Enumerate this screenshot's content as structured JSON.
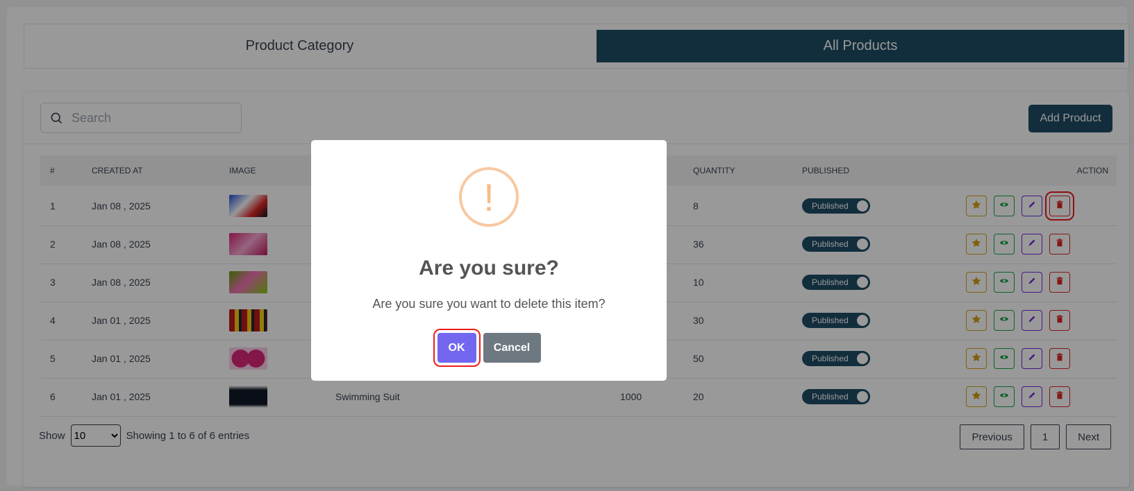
{
  "tabs": {
    "category": "Product Category",
    "all": "All Products"
  },
  "toolbar": {
    "search_placeholder": "Search",
    "add_label": "Add Product"
  },
  "table": {
    "headers": {
      "num": "#",
      "created": "CREATED AT",
      "image": "IMAGE",
      "quantity": "QUANTITY",
      "published": "PUBLISHED",
      "action": "ACTION"
    },
    "rows": [
      {
        "num": "1",
        "created": "Jan 08 , 2025",
        "name": "",
        "price": "",
        "quantity": "8",
        "published": "Published"
      },
      {
        "num": "2",
        "created": "Jan 08 , 2025",
        "name": "",
        "price": "",
        "quantity": "36",
        "published": "Published"
      },
      {
        "num": "3",
        "created": "Jan 08 , 2025",
        "name": "",
        "price": "",
        "quantity": "10",
        "published": "Published"
      },
      {
        "num": "4",
        "created": "Jan 01 , 2025",
        "name": "",
        "price": "",
        "quantity": "30",
        "published": "Published"
      },
      {
        "num": "5",
        "created": "Jan 01 , 2025",
        "name": "",
        "price": "",
        "quantity": "50",
        "published": "Published"
      },
      {
        "num": "6",
        "created": "Jan 01 , 2025",
        "name": "Swimming Suit",
        "price": "1000",
        "quantity": "20",
        "published": "Published"
      }
    ]
  },
  "footer": {
    "show_label": "Show",
    "page_size": "10",
    "entries_text": "Showing 1 to 6 of 6 entries",
    "prev": "Previous",
    "page": "1",
    "next": "Next"
  },
  "modal": {
    "icon": "!",
    "title": "Are you sure?",
    "text": "Are you sure you want to delete this item?",
    "ok": "OK",
    "cancel": "Cancel"
  },
  "colors": {
    "primary": "#1f4e66",
    "confirm": "#7367f0",
    "cancel": "#6e7881",
    "warning": "#f8bb86"
  },
  "icons": {
    "star": "star-icon",
    "view": "eye-icon",
    "edit": "pencil-icon",
    "delete": "trash-icon",
    "search": "search-icon"
  }
}
